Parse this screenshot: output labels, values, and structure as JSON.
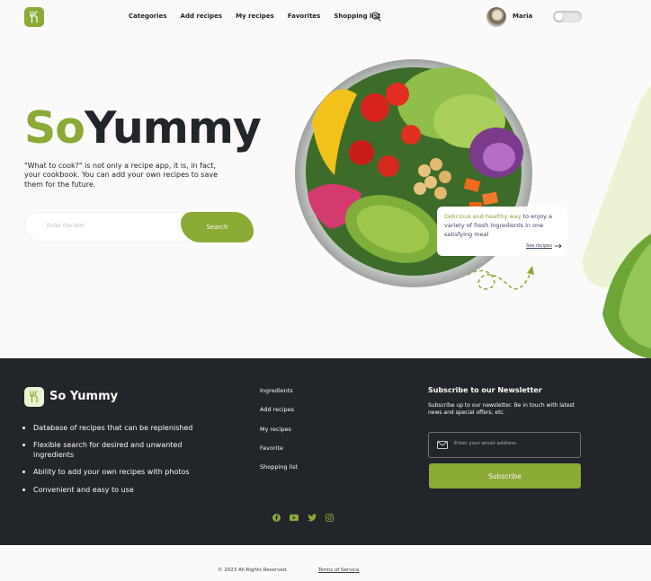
{
  "header": {
    "logo_icon": "fork-knife-icon",
    "nav": [
      {
        "label": "Categories"
      },
      {
        "label": "Add recipes"
      },
      {
        "label": "My recipes"
      },
      {
        "label": "Favorites"
      },
      {
        "label": "Shopping list"
      }
    ],
    "search_icon": "search-icon",
    "user_name": "Maria",
    "theme_toggle_on": false
  },
  "hero": {
    "title_part1": "So",
    "title_part2": "Yummy",
    "description": "\"What to cook?\" is not only a recipe app, it is, in fact, your cookbook. You can add your own recipes to save them for the future.",
    "search_placeholder": "Enter the text",
    "search_button": "Search",
    "promo_highlight": "Delicious and healthy way",
    "promo_text": " to enjoy a variety of fresh ingredients in one satisfying meal",
    "promo_link": "See recipes"
  },
  "footer": {
    "brand": "So Yummy",
    "features": [
      "Database of recipes that can be replenished",
      "Flexible search for desired and unwanted ingredients",
      "Ability to add your own recipes with photos",
      "Convenient and easy to use"
    ],
    "links": [
      "Ingredients",
      "Add recipes",
      "My recipes",
      "Favorite",
      "Shopping list"
    ],
    "newsletter_title": "Subscribe to our Newsletter",
    "newsletter_desc": "Subscribe up to our newsletter. Be in touch with latest news and special offers, etc.",
    "email_placeholder": "Enter your email address",
    "subscribe_button": "Subscribe",
    "socials": [
      "facebook-icon",
      "youtube-icon",
      "twitter-icon",
      "instagram-icon"
    ],
    "copyright": "© 2023 All Rights Reserved.",
    "terms": "Terms of Service"
  },
  "colors": {
    "accent": "#8baa36",
    "dark": "#22252a",
    "light_green": "#ebf3d4"
  }
}
